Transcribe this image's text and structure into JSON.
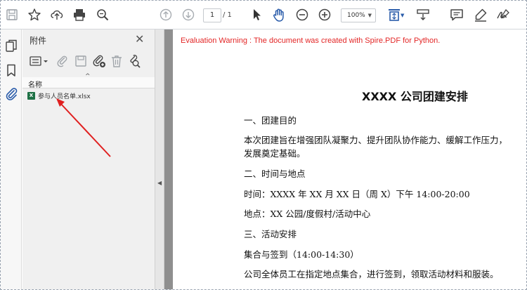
{
  "toolbar": {
    "page_current": "1",
    "page_total": "/ 1",
    "zoom": "100%",
    "icons": [
      "save-icon",
      "star-icon",
      "upload-icon",
      "print-icon",
      "search-zoom-icon",
      "page-up-icon",
      "page-down-icon",
      "select-arrow-icon",
      "hand-tool-icon",
      "zoom-out-icon",
      "zoom-in-icon",
      "fit-page-icon",
      "scroll-mode-icon",
      "comment-icon",
      "highlight-icon",
      "sign-icon"
    ]
  },
  "rail": {
    "icons": [
      "pages-icon",
      "bookmark-icon",
      "attachment-icon"
    ]
  },
  "panel": {
    "title": "附件",
    "column_header": "名称",
    "file": {
      "name": "参与人员名单.xlsx",
      "icon_letter": "X"
    }
  },
  "document": {
    "warning": "Evaluation Warning : The document was created with Spire.PDF for Python.",
    "title": "XXXX 公司团建安排",
    "lines": [
      "一、团建目的",
      "本次团建旨在增强团队凝聚力、提升团队协作能力、缓解工作压力，",
      "发展奠定基础。",
      "二、时间与地点",
      "时间：XXXX 年 XX 月 XX 日（周 X）下午 14:00-20:00",
      "地点：XX 公园/度假村/活动中心",
      "三、活动安排",
      "集合与签到（14:00-14:30）",
      "公司全体员工在指定地点集合，进行签到，领取活动材料和服装。"
    ]
  },
  "colors": {
    "accent": "#2a5caa",
    "warning": "#e32626",
    "arrow": "#e02020"
  }
}
